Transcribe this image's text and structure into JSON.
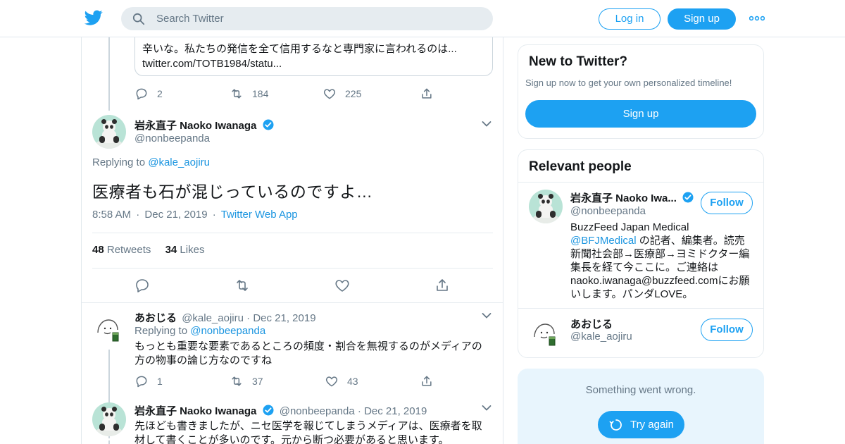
{
  "header": {
    "search_placeholder": "Search Twitter",
    "login_label": "Log in",
    "signup_label": "Sign up"
  },
  "quoted_tweet": {
    "text_line1": "辛いな。私たちの発信を全て信用するなと専門家に言われるのは...",
    "text_line2": "twitter.com/TOTB1984/statu..."
  },
  "prev_tweet_actions": {
    "replies": "2",
    "retweets": "184",
    "likes": "225"
  },
  "main_tweet": {
    "name": "岩永直子 Naoko Iwanaga",
    "handle": "@nonbeepanda",
    "replying_to_label": "Replying to",
    "replying_to_handle": "@kale_aojiru",
    "text": "医療者も石が混じっているのですよ…",
    "time": "8:58 AM",
    "date": "Dec 21, 2019",
    "source": "Twitter Web App",
    "retweets_count": "48",
    "retweets_label": "Retweets",
    "likes_count": "34",
    "likes_label": "Likes"
  },
  "reply1": {
    "name": "あおじる",
    "handle": "@kale_aojiru",
    "date": "Dec 21, 2019",
    "replying_to_label": "Replying to",
    "replying_to_handle": "@nonbeepanda",
    "text_line1": "もっとも重要な要素であるところの頻度・割合を無視するのがメディアの",
    "text_line2": "方の物事の論じ方なのですね",
    "replies": "1",
    "retweets": "37",
    "likes": "43"
  },
  "reply2": {
    "name": "岩永直子 Naoko Iwanaga",
    "handle": "@nonbeepanda",
    "date": "Dec 21, 2019",
    "text_line1": "先ほども書きましたが、ニセ医学を報じてしまうメディアは、医療者を取",
    "text_line2": "材して書くことが多いのです。元から断つ必要があると思います。"
  },
  "sidebar": {
    "new_title": "New to Twitter?",
    "new_subtitle": "Sign up now to get your own personalized timeline!",
    "signup_label": "Sign up",
    "relevant_title": "Relevant people",
    "person1": {
      "name": "岩永直子 Naoko Iwa...",
      "handle": "@nonbeepanda",
      "follow_label": "Follow",
      "bio_line1": "BuzzFeed Japan Medical",
      "bio_link": "@BFJMedical",
      "bio_line2_rest": " の記者、編集者。読売",
      "bio_line3": "新聞社会部→医療部→ヨミドクター編",
      "bio_line4": "集長を経て今ここに。ご連絡は",
      "bio_line5": "naoko.iwanaga@buzzfeed.comにお願",
      "bio_line6": "いします。パンダLOVE。"
    },
    "person2": {
      "name": "あおじる",
      "handle": "@kale_aojiru",
      "follow_label": "Follow"
    },
    "error_text": "Something went wrong.",
    "retry_label": "Try again"
  },
  "colors": {
    "brand": "#1da1f2",
    "link": "#1b95e0",
    "muted": "#657786",
    "border": "#e6ecf0"
  }
}
